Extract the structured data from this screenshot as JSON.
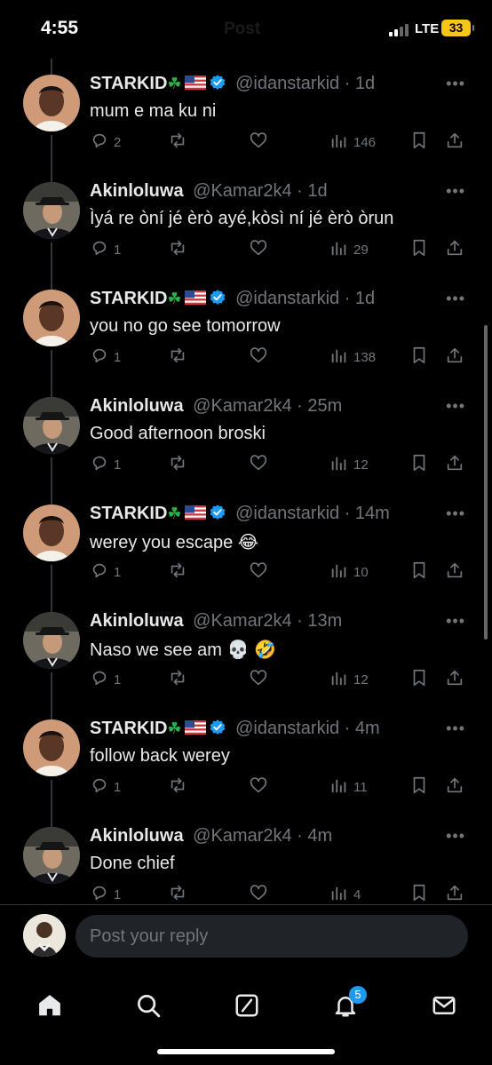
{
  "status_bar": {
    "time": "4:55",
    "network": "LTE",
    "battery": "33",
    "header_title": "Post"
  },
  "tweets": [
    {
      "author": "STARKID",
      "handle": "@idanstarkid",
      "time": "1d",
      "verified": true,
      "emojis": true,
      "avatar": "starkid",
      "text": "mum e ma ku ni",
      "replies": "2",
      "views": "146"
    },
    {
      "author": "Akinloluwa",
      "handle": "@Kamar2k4",
      "time": "1d",
      "verified": false,
      "emojis": false,
      "avatar": "akinloluwa",
      "text": "Ìyá re òní jé èrò ayé,kòsì ní jé èrò òrun",
      "replies": "1",
      "views": "29"
    },
    {
      "author": "STARKID",
      "handle": "@idanstarkid",
      "time": "1d",
      "verified": true,
      "emojis": true,
      "avatar": "starkid",
      "text": "you no go see tomorrow",
      "replies": "1",
      "views": "138"
    },
    {
      "author": "Akinloluwa",
      "handle": "@Kamar2k4",
      "time": "25m",
      "verified": false,
      "emojis": false,
      "avatar": "akinloluwa",
      "text": "Good afternoon broski",
      "replies": "1",
      "views": "12"
    },
    {
      "author": "STARKID",
      "handle": "@idanstarkid",
      "time": "14m",
      "verified": true,
      "emojis": true,
      "avatar": "starkid",
      "text": "werey you escape 😂",
      "replies": "1",
      "views": "10"
    },
    {
      "author": "Akinloluwa",
      "handle": "@Kamar2k4",
      "time": "13m",
      "verified": false,
      "emojis": false,
      "avatar": "akinloluwa",
      "text": "Naso we see am 💀 🤣",
      "replies": "1",
      "views": "12"
    },
    {
      "author": "STARKID",
      "handle": "@idanstarkid",
      "time": "4m",
      "verified": true,
      "emojis": true,
      "avatar": "starkid",
      "text": "follow back werey",
      "replies": "1",
      "views": "11"
    },
    {
      "author": "Akinloluwa",
      "handle": "@Kamar2k4",
      "time": "4m",
      "verified": false,
      "emojis": false,
      "avatar": "akinloluwa",
      "text": "Done chief",
      "replies": "1",
      "views": "4"
    }
  ],
  "reply": {
    "placeholder": "Post your reply"
  },
  "tab_bar": {
    "items": [
      "home-icon",
      "search-icon",
      "grok-icon",
      "notifications-icon",
      "messages-icon"
    ],
    "notifications_badge": "5"
  },
  "colors": {
    "background": "#000000",
    "text": "#e7e9ea",
    "muted": "#71767b",
    "accent": "#1d9bf0"
  }
}
